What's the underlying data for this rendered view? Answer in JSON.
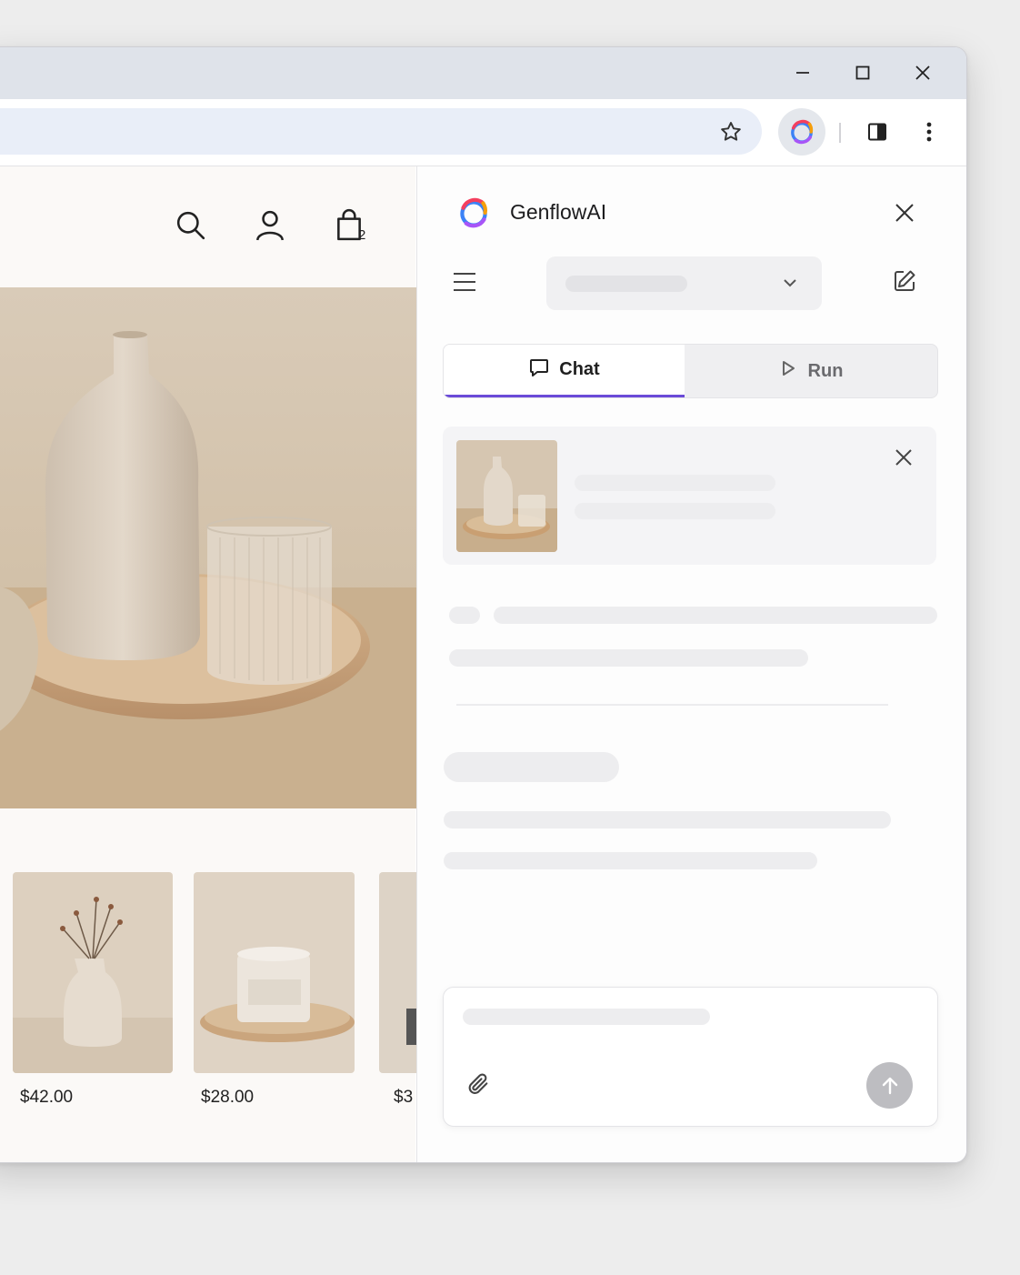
{
  "browser": {
    "window_controls": {
      "minimize_icon": "minimize-icon",
      "maximize_icon": "maximize-icon",
      "close_icon": "close-icon"
    },
    "toolbar_icons": [
      "star-icon",
      "genflow-extension-icon",
      "side-panel-icon",
      "kebab-menu-icon"
    ]
  },
  "store": {
    "header_icons": [
      "search-icon",
      "account-icon",
      "shopping-bag-icon"
    ],
    "cart_count": "2",
    "products": [
      {
        "price": "$42.00",
        "image": "dried-flowers-vase"
      },
      {
        "price": "$28.00",
        "image": "candle-on-tray"
      },
      {
        "price": "$3",
        "image": "partial-product"
      }
    ]
  },
  "panel": {
    "brand": "GenflowAI",
    "tabs": [
      {
        "label": "Chat",
        "icon": "chat-bubble-icon",
        "active": true
      },
      {
        "label": "Run",
        "icon": "play-icon",
        "active": false
      }
    ],
    "colors": {
      "accent": "#6b4bd8"
    }
  }
}
